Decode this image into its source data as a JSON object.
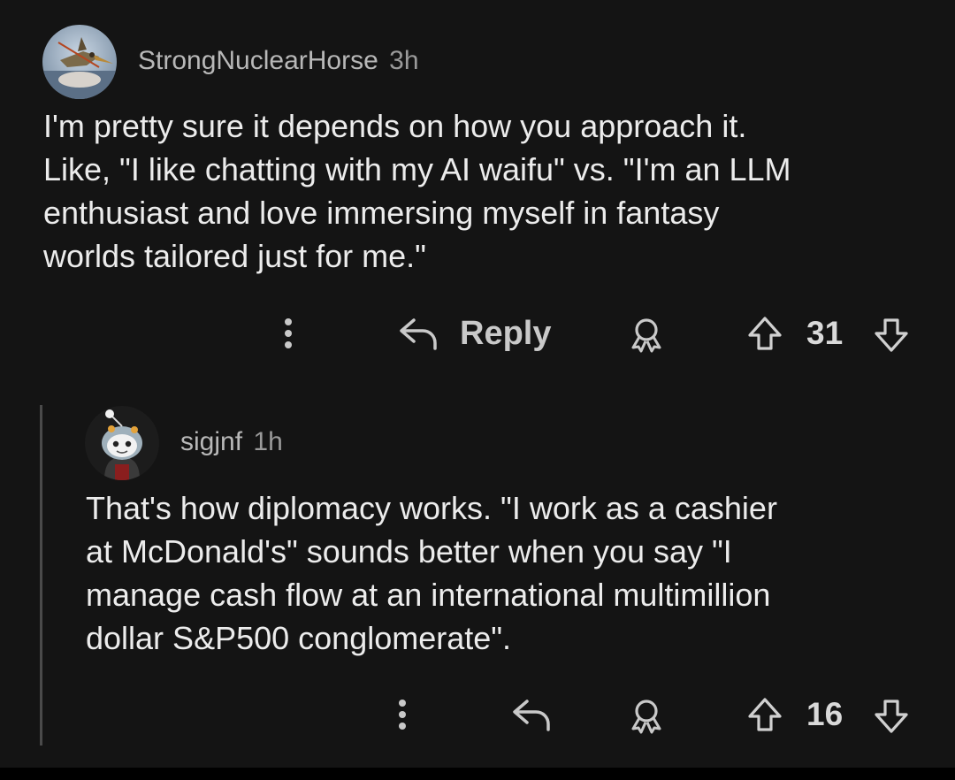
{
  "comments": [
    {
      "username": "StrongNuclearHorse",
      "time": "3h",
      "lines": [
        "I'm pretty sure it depends on how you approach it.",
        "Like, \"I like chatting with my AI waifu\" vs. \"I'm an LLM",
        "enthusiast and love immersing myself in fantasy",
        "worlds tailored just for me.\""
      ],
      "reply_label": "Reply",
      "votes": "31"
    },
    {
      "username": "sigjnf",
      "time": "1h",
      "lines": [
        "That's how diplomacy works. \"I work as a cashier",
        "at McDonald's\" sounds better when you say \"I",
        "manage cash flow at an international multimillion",
        "dollar S&P500 conglomerate\"."
      ],
      "votes": "16"
    }
  ],
  "icons": {
    "more": "more-vertical-icon",
    "reply": "reply-arrow-icon",
    "award": "award-icon",
    "upvote": "upvote-arrow-icon",
    "downvote": "downvote-arrow-icon"
  },
  "colors": {
    "background": "#141414",
    "text": "#ececec",
    "muted": "#b8b8b8"
  }
}
